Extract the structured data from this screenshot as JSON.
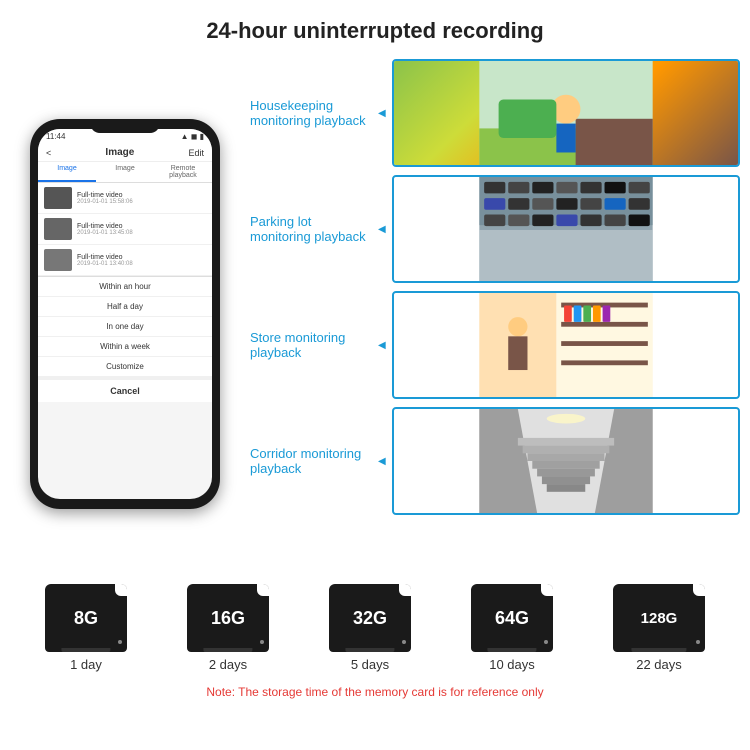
{
  "header": {
    "title": "24-hour uninterrupted recording"
  },
  "phone": {
    "status_time": "11:44",
    "nav_back": "<",
    "nav_title": "Image",
    "nav_edit": "Edit",
    "tabs": [
      "Image",
      "Image",
      "Remote playback"
    ],
    "list_items": [
      {
        "title": "Full-time video",
        "time": "2019-01-01 15:58:06"
      },
      {
        "title": "Full-time video",
        "time": "2019-01-01 13:45:08"
      },
      {
        "title": "Full-time video",
        "time": "2019-01-01 13:40:08"
      }
    ],
    "dropdown_items": [
      "Within an hour",
      "Half a day",
      "In one day",
      "Within a week",
      "Customize"
    ],
    "cancel_label": "Cancel"
  },
  "monitoring": [
    {
      "label": "Housekeeping monitoring playback"
    },
    {
      "label": "Parking lot monitoring playback"
    },
    {
      "label": "Store monitoring playback"
    },
    {
      "label": "Corridor monitoring playback"
    }
  ],
  "storage": {
    "cards": [
      {
        "capacity": "8G",
        "days": "1 day"
      },
      {
        "capacity": "16G",
        "days": "2 days"
      },
      {
        "capacity": "32G",
        "days": "5 days"
      },
      {
        "capacity": "64G",
        "days": "10 days"
      },
      {
        "capacity": "128G",
        "days": "22 days"
      }
    ],
    "note": "Note: The storage time of the memory card is for reference only"
  }
}
